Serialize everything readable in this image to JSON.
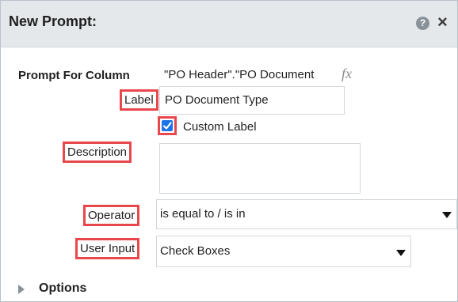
{
  "dialog": {
    "title": "New Prompt:",
    "help_icon": "question-circle-icon",
    "close_icon": "close-x-icon"
  },
  "form": {
    "prompt_for_column_label": "Prompt For Column",
    "prompt_for_column_value": "\"PO Header\".\"PO Document",
    "formula_icon_text": "fx",
    "label_label": "Label",
    "label_value": "PO Document Type",
    "custom_label_text": "Custom Label",
    "custom_label_checked": true,
    "description_label": "Description",
    "description_value": "",
    "operator_label": "Operator",
    "operator_value": "is equal to / is in",
    "user_input_label": "User Input",
    "user_input_value": "Check Boxes"
  },
  "options": {
    "label": "Options"
  },
  "colors": {
    "highlight_border": "#e8474c",
    "checkbox_fill": "#1a73e8",
    "titlebar_bg": "#e4e8eb"
  }
}
